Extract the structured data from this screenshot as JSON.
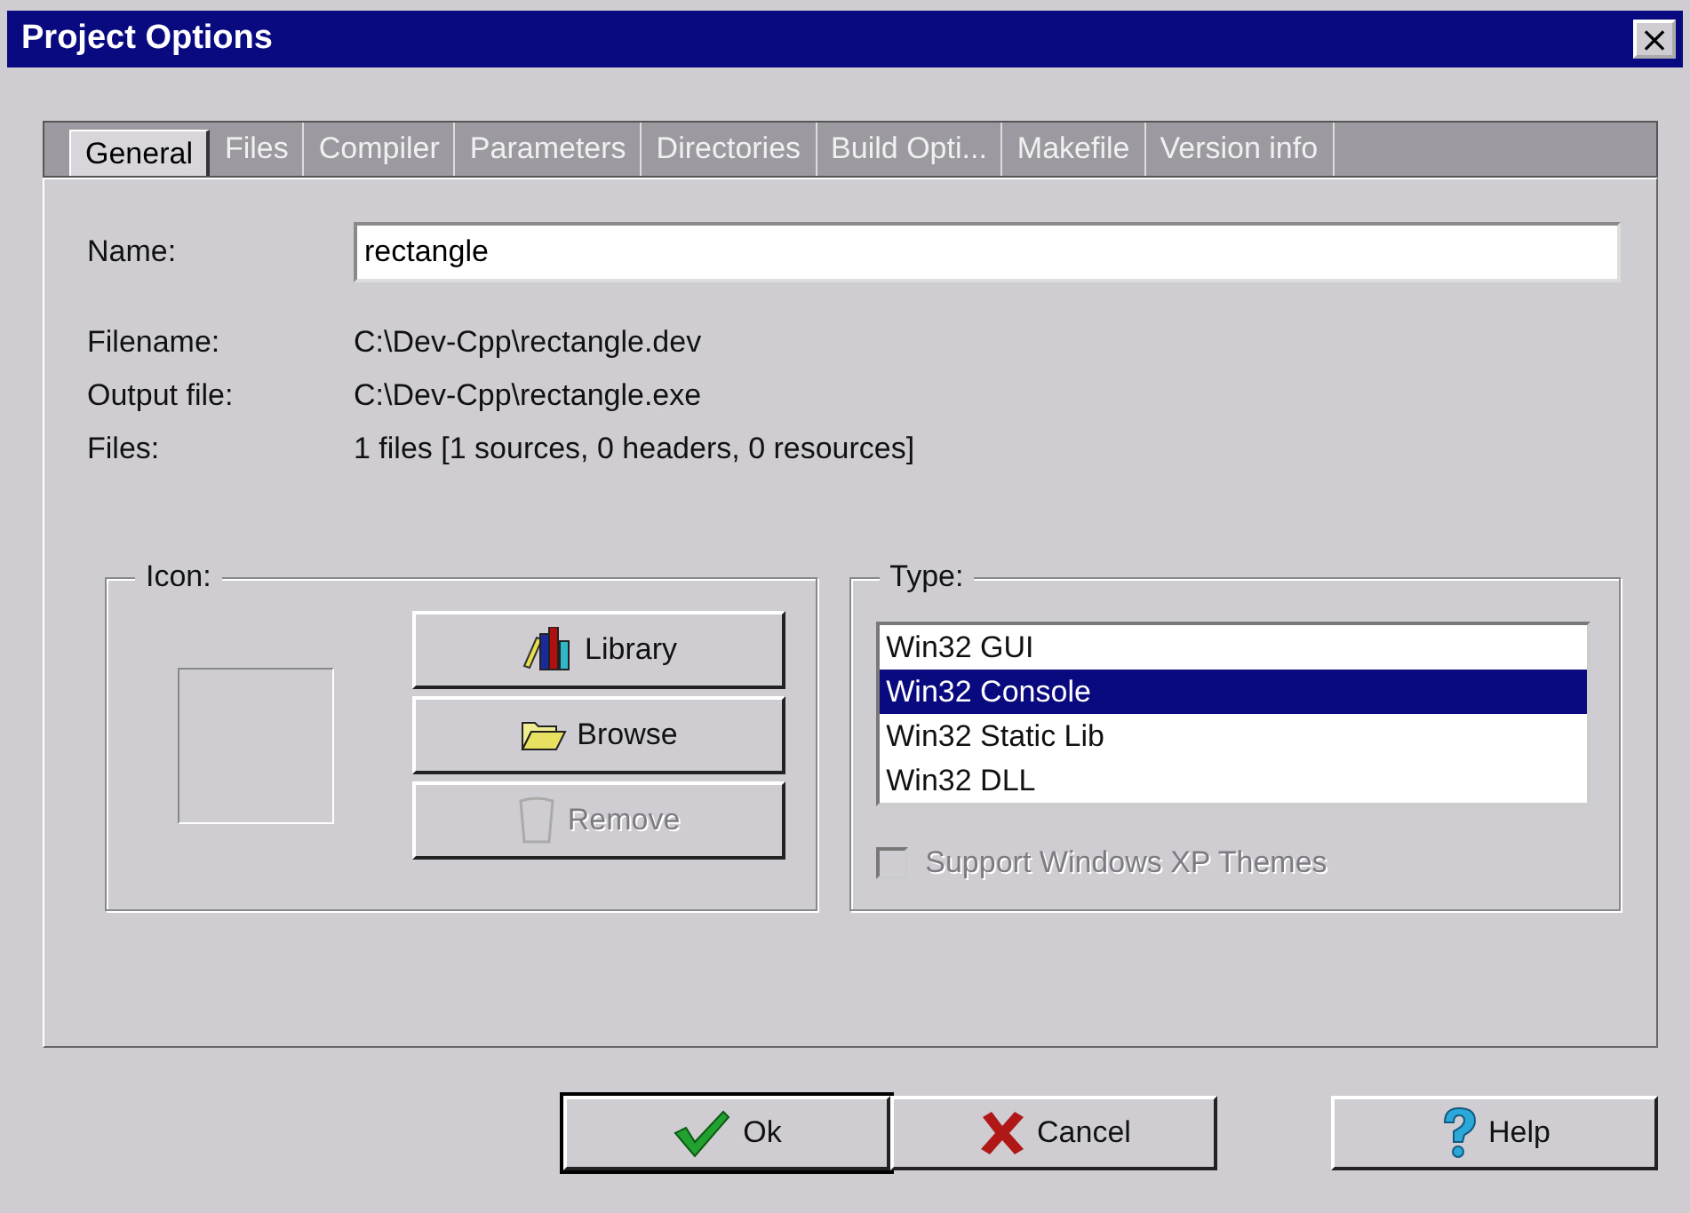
{
  "window": {
    "title": "Project Options",
    "close": "×"
  },
  "tabs": [
    {
      "label": "General",
      "selected": true
    },
    {
      "label": "Files",
      "selected": false
    },
    {
      "label": "Compiler",
      "selected": false
    },
    {
      "label": "Parameters",
      "selected": false
    },
    {
      "label": "Directories",
      "selected": false
    },
    {
      "label": "Build Opti...",
      "selected": false
    },
    {
      "label": "Makefile",
      "selected": false
    },
    {
      "label": "Version info",
      "selected": false
    }
  ],
  "name": {
    "label": "Name:",
    "value": "rectangle"
  },
  "info": [
    {
      "label": "Filename:",
      "value": "C:\\Dev-Cpp\\rectangle.dev"
    },
    {
      "label": "Output file:",
      "value": "C:\\Dev-Cpp\\rectangle.exe"
    },
    {
      "label": "Files:",
      "value": "1 files [1 sources, 0 headers, 0 resources]"
    }
  ],
  "icon_group": {
    "title": "Icon:",
    "buttons": [
      {
        "label": "Library",
        "kind": "library",
        "disabled": false
      },
      {
        "label": "Browse",
        "kind": "browse",
        "disabled": false
      },
      {
        "label": "Remove",
        "kind": "remove",
        "disabled": true
      }
    ]
  },
  "type_group": {
    "title": "Type:",
    "items": [
      {
        "label": "Win32 GUI",
        "selected": false
      },
      {
        "label": "Win32 Console",
        "selected": true
      },
      {
        "label": "Win32 Static Lib",
        "selected": false
      },
      {
        "label": "Win32 DLL",
        "selected": false
      }
    ],
    "xp_themes": {
      "label": "Support Windows XP Themes",
      "checked": false,
      "disabled": true
    }
  },
  "buttons": [
    {
      "label": "Ok",
      "kind": "ok",
      "default": true
    },
    {
      "label": "Cancel",
      "kind": "cancel",
      "default": false
    },
    {
      "label": "Help",
      "kind": "help",
      "default": false
    }
  ]
}
